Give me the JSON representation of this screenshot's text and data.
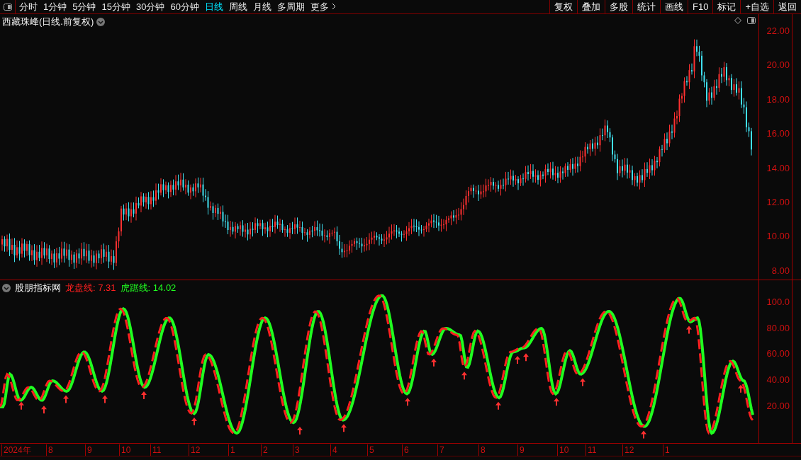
{
  "periods": [
    {
      "label": "分时",
      "selected": false
    },
    {
      "label": "1分钟",
      "selected": false
    },
    {
      "label": "5分钟",
      "selected": false
    },
    {
      "label": "15分钟",
      "selected": false
    },
    {
      "label": "30分钟",
      "selected": false
    },
    {
      "label": "60分钟",
      "selected": false
    },
    {
      "label": "日线",
      "selected": true
    },
    {
      "label": "周线",
      "selected": false
    },
    {
      "label": "月线",
      "selected": false
    },
    {
      "label": "多周期",
      "selected": false
    },
    {
      "label": "更多",
      "selected": false
    }
  ],
  "actions": [
    "复权",
    "叠加",
    "多股",
    "统计",
    "画线",
    "F10",
    "标记",
    "+自选",
    "返回"
  ],
  "price_panel": {
    "title": "西藏珠峰(日线.前复权)",
    "axis_labels": [
      "22.00",
      "20.00",
      "18.00",
      "16.00",
      "14.00",
      "12.00",
      "10.00",
      "8.00"
    ]
  },
  "indicator_panel": {
    "name": "股朋指标网",
    "readouts": [
      {
        "label": "龙盘线:",
        "value": "7.31",
        "color": "#ff2020"
      },
      {
        "label": "虎踞线:",
        "value": "14.02",
        "color": "#20ff20"
      }
    ],
    "axis_labels": [
      "100.0",
      "80.00",
      "60.00",
      "40.00",
      "20.00"
    ]
  },
  "date_axis": [
    "2024年",
    "8",
    "9",
    "10",
    "11",
    "12",
    "1",
    "2",
    "3",
    "4",
    "5",
    "6",
    "7",
    "8",
    "9",
    "10",
    "11",
    "12",
    "1"
  ]
}
